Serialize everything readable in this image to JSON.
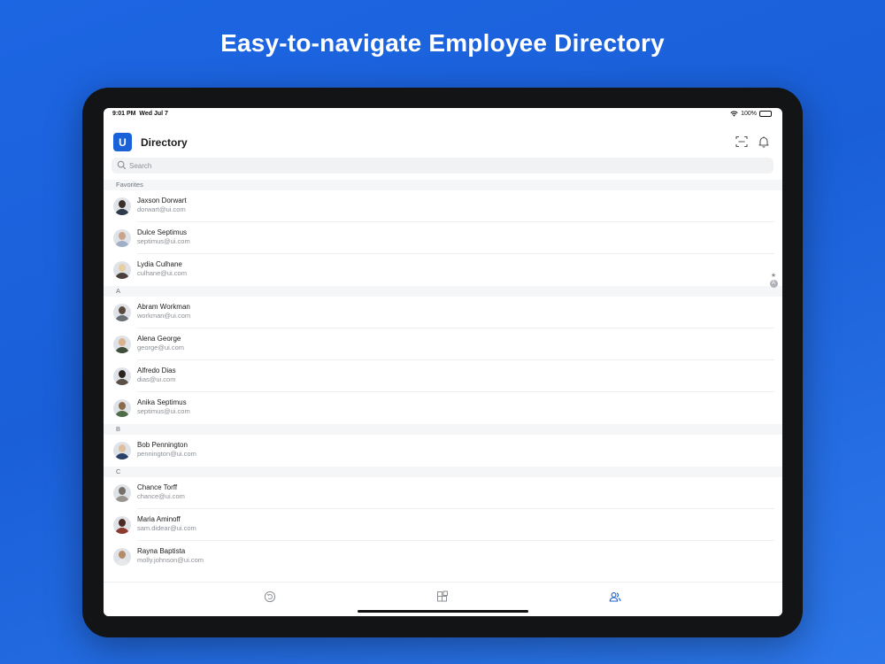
{
  "headline": "Easy-to-navigate Employee Directory",
  "status": {
    "time": "9:01 PM",
    "date": "Wed Jul 7",
    "battery": "100%"
  },
  "app": {
    "logo_letter": "U",
    "title": "Directory"
  },
  "search": {
    "placeholder": "Search"
  },
  "sections": [
    {
      "label": "Favorites",
      "rows": [
        {
          "name": "Jaxson Dorwart",
          "email": "dorwart@ui.com"
        },
        {
          "name": "Dulce Septimus",
          "email": "septimus@ui.com"
        },
        {
          "name": "Lydia Culhane",
          "email": "culhane@ui.com"
        }
      ]
    },
    {
      "label": "A",
      "rows": [
        {
          "name": "Abram Workman",
          "email": "workman@ui.com"
        },
        {
          "name": "Alena George",
          "email": "george@ui.com"
        },
        {
          "name": "Alfredo Dias",
          "email": "dias@ui.com"
        },
        {
          "name": "Anika Septimus",
          "email": "septimus@ui.com"
        }
      ]
    },
    {
      "label": "B",
      "rows": [
        {
          "name": "Bob Pennington",
          "email": "pennington@ui.com"
        }
      ]
    },
    {
      "label": "C",
      "rows": [
        {
          "name": "Chance Torff",
          "email": "chance@ui.com"
        },
        {
          "name": "Maria Aminoff",
          "email": "sam.didear@ui.com"
        },
        {
          "name": "Rayna Baptista",
          "email": "molly.johnson@ui.com"
        }
      ]
    }
  ],
  "index_bar": {
    "star": "★",
    "letter": "A"
  },
  "icons": {
    "scan": "scan-icon",
    "bell": "bell-icon",
    "search": "search-icon",
    "tab_history": "history-icon",
    "tab_apps": "apps-grid-icon",
    "tab_people": "people-icon"
  },
  "colors": {
    "brand": "#1b61d8",
    "active_tab": "#1b61d8",
    "inactive_tab": "#8b8f96"
  }
}
